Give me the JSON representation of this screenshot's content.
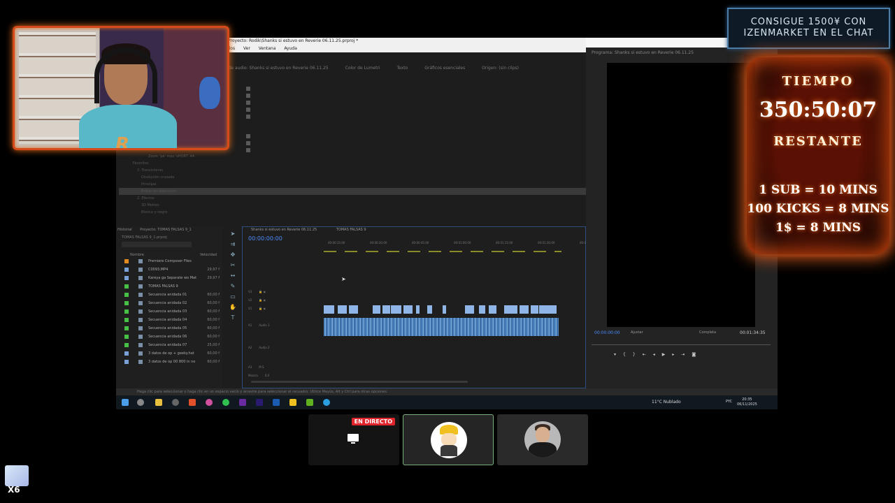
{
  "premiere": {
    "title": "Proyecto: Rodik\\Shanks si estuvo en Reverie 06.11.25.prproj *",
    "menu": [
      "y títulos",
      "Ver",
      "Ventana",
      "Ayuda"
    ],
    "source_tabs": [
      "ico de audio: Shanks si estuvo en Reverie 06.11.25",
      "Color de Lumetri",
      "Texto",
      "Gráficos esenciales",
      "Origen: (sin clips)"
    ],
    "effects": [
      "Zoom 'pe' mas 'sHORT' 44",
      "Favoritos",
      "3. Transiciones",
      "Disolución cruzada",
      "Principal",
      "Entrar en disolución",
      "2. Efectos",
      "3D Motion",
      "Blanco y negro"
    ],
    "program": {
      "title": "Programa: Shanks si estuvo en Reverie 06.11.25",
      "timecode": "00:00:00:00",
      "fit": "Ajustar",
      "quality": "Completa",
      "duration": "00:01:34:35"
    },
    "project": {
      "tabs": [
        "Historial",
        "Proyecto: TOMAS FALSAS 9_1"
      ],
      "file": "TOMAS FALSAS 9_1.prproj",
      "col_name": "Nombre",
      "col_speed": "Velocidad",
      "rows": [
        {
          "name": "Premiere Composer Files",
          "fps": "",
          "color": "#e08a20"
        },
        {
          "name": "C0093.MP4",
          "fps": "29,97 f",
          "color": "#7aa0d8"
        },
        {
          "name": "Kareya ga Separate wo Mat",
          "fps": "29,97 f",
          "color": "#7aa0d8"
        },
        {
          "name": "TOMAS FALSAS 9",
          "fps": "",
          "color": "#48c048"
        },
        {
          "name": "Secuencia anidada 01",
          "fps": "60,00 f",
          "color": "#48c048"
        },
        {
          "name": "Secuencia anidada 02",
          "fps": "60,00 f",
          "color": "#48c048"
        },
        {
          "name": "Secuencia anidada 03",
          "fps": "60,00 f",
          "color": "#48c048"
        },
        {
          "name": "Secuencia anidada 04",
          "fps": "60,00 f",
          "color": "#48c048"
        },
        {
          "name": "Secuencia anidada 05",
          "fps": "60,00 f",
          "color": "#48c048"
        },
        {
          "name": "Secuencia anidada 06",
          "fps": "60,00 f",
          "color": "#48c048"
        },
        {
          "name": "Secuencia anidada 07",
          "fps": "25,00 f",
          "color": "#48c048"
        },
        {
          "name": "3 datos de op + geeky.hat",
          "fps": "60,00 f",
          "color": "#7aa0d8"
        },
        {
          "name": "3 datos de op 00 800 in no",
          "fps": "60,00 f",
          "color": "#7aa0d8"
        }
      ]
    },
    "timeline": {
      "tabs": [
        "Shanks si estuvo en Reverie 06.11.25",
        "TOMAS FALSAS 9"
      ],
      "timecode": "00:00:00:00",
      "ruler": [
        "00:00:15:00",
        "00:00:30:00",
        "00:00:45:00",
        "00:01:00:00",
        "00:01:15:00",
        "00:01:30:00",
        "00:0"
      ],
      "tracks": [
        "V3",
        "V2",
        "V1",
        "A1",
        "A2",
        "A3",
        "Mezcla"
      ],
      "audio_label": "Audio 1",
      "audio2_label": "Audio 2",
      "mix_value": "0,0"
    },
    "status": "Haga clic para seleccionar o haga clic en un espacio vacío y arrastre para seleccionar el recuadro. Utilice Mayús, Alt y Ctrl para otras opciones.",
    "taskbar": {
      "weather": "11°C  Nublado",
      "lang": "PYC",
      "time": "20:35",
      "date": "06/11/2025"
    }
  },
  "banner": {
    "line1": "CONSIGUE 1500¥ CON",
    "line2": "IZENMARKET EN EL CHAT"
  },
  "timer": {
    "label": "TIEMPO",
    "value": "350:50:07",
    "remaining": "RESTANTE",
    "rules": [
      "1 SUB = 10 MINS",
      "100 KICKS = 8 MINS",
      "1$ = 8 MINS"
    ]
  },
  "tiles": {
    "live_badge": "EN DIRECTO"
  },
  "badge": {
    "text": "X6"
  }
}
